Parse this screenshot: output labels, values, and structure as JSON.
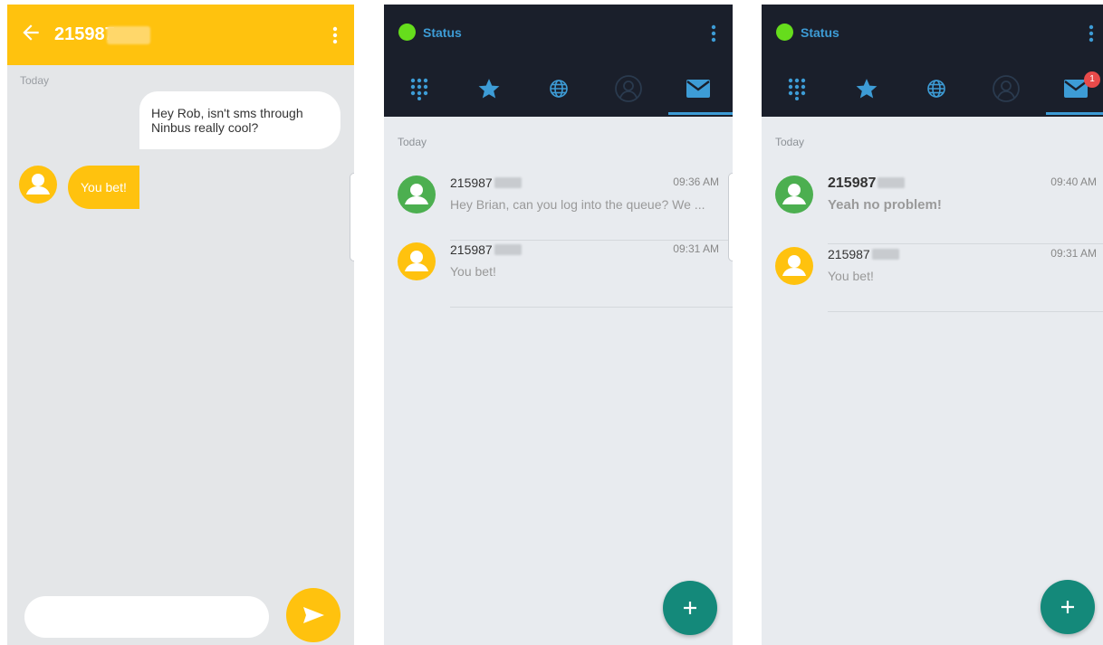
{
  "conversation": {
    "title": "215987",
    "day_label": "Today",
    "messages": [
      {
        "direction": "outgoing",
        "text": "Hey Rob, isn't sms through Ninbus really cool?"
      },
      {
        "direction": "incoming",
        "text": "You bet!"
      }
    ],
    "compose_placeholder": "",
    "icons": {
      "back": "arrow-left-icon",
      "menu": "more-vert-icon",
      "send": "send-icon",
      "avatar": "person-icon"
    }
  },
  "inbox_before": {
    "status_label": "Status",
    "tabs": [
      "dialpad-icon",
      "star-icon",
      "globe-icon",
      "contacts-icon",
      "mail-icon"
    ],
    "active_tab": "mail-icon",
    "day_label": "Today",
    "threads": [
      {
        "name": "215987",
        "time": "09:36 AM",
        "preview": "Hey Brian, can you log into the queue? We ...",
        "avatar_color": "#4caf50",
        "unread": false
      },
      {
        "name": "215987",
        "time": "09:31 AM",
        "preview": "You bet!",
        "avatar_color": "#ffc20e",
        "unread": false
      }
    ],
    "fab_label": "+"
  },
  "inbox_after": {
    "status_label": "Status",
    "tabs": [
      "dialpad-icon",
      "star-icon",
      "globe-icon",
      "contacts-icon",
      "mail-icon"
    ],
    "active_tab": "mail-icon",
    "mail_badge": "1",
    "day_label": "Today",
    "threads": [
      {
        "name": "215987",
        "time": "09:40 AM",
        "preview": "Yeah no problem!",
        "avatar_color": "#4caf50",
        "unread": true
      },
      {
        "name": "215987",
        "time": "09:31 AM",
        "preview": "You bet!",
        "avatar_color": "#ffc20e",
        "unread": false
      }
    ],
    "fab_label": "+"
  },
  "colors": {
    "accent_yellow": "#ffc20e",
    "appbar_dark": "#1a1f2b",
    "status_green": "#66dd1c",
    "link_blue": "#3d9cd6",
    "fab_teal": "#14897a",
    "badge_red": "#e84a4a"
  }
}
